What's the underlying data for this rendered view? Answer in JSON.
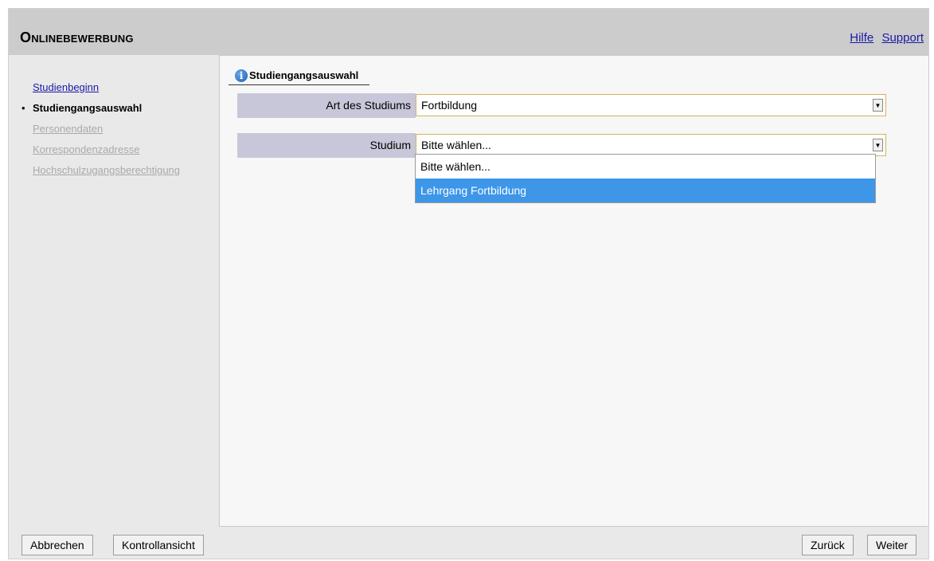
{
  "header": {
    "title": "Onlinebewerbung",
    "links": {
      "help": "Hilfe",
      "support": "Support"
    }
  },
  "sidebar": {
    "items": [
      {
        "label": "Studienbeginn",
        "state": "link"
      },
      {
        "label": "Studiengangsauswahl",
        "state": "current"
      },
      {
        "label": "Personendaten",
        "state": "disabled"
      },
      {
        "label": "Korrespondenzadresse",
        "state": "disabled"
      },
      {
        "label": "Hochschulzugangsberechtigung",
        "state": "disabled"
      }
    ],
    "bullet": "•"
  },
  "main": {
    "section_title": "Studiengangsauswahl",
    "fields": {
      "art": {
        "label": "Art des Studiums",
        "value": "Fortbildung"
      },
      "studium": {
        "label": "Studium",
        "value": "Bitte wählen..."
      }
    },
    "dropdown": {
      "options": [
        "Bitte wählen...",
        "Lehrgang Fortbildung"
      ],
      "highlighted": "Lehrgang Fortbildung"
    }
  },
  "footer": {
    "cancel": "Abbrechen",
    "review": "Kontrollansicht",
    "back": "Zurück",
    "next": "Weiter"
  },
  "colors": {
    "header_bg": "#cccccc",
    "label_bg": "#c7c7d9",
    "select_border": "#d4b25a",
    "highlight": "#3d96e8",
    "link": "#1a1aa6"
  },
  "icons": {
    "section": "info-icon",
    "select_arrow": "chevron-down-icon"
  }
}
